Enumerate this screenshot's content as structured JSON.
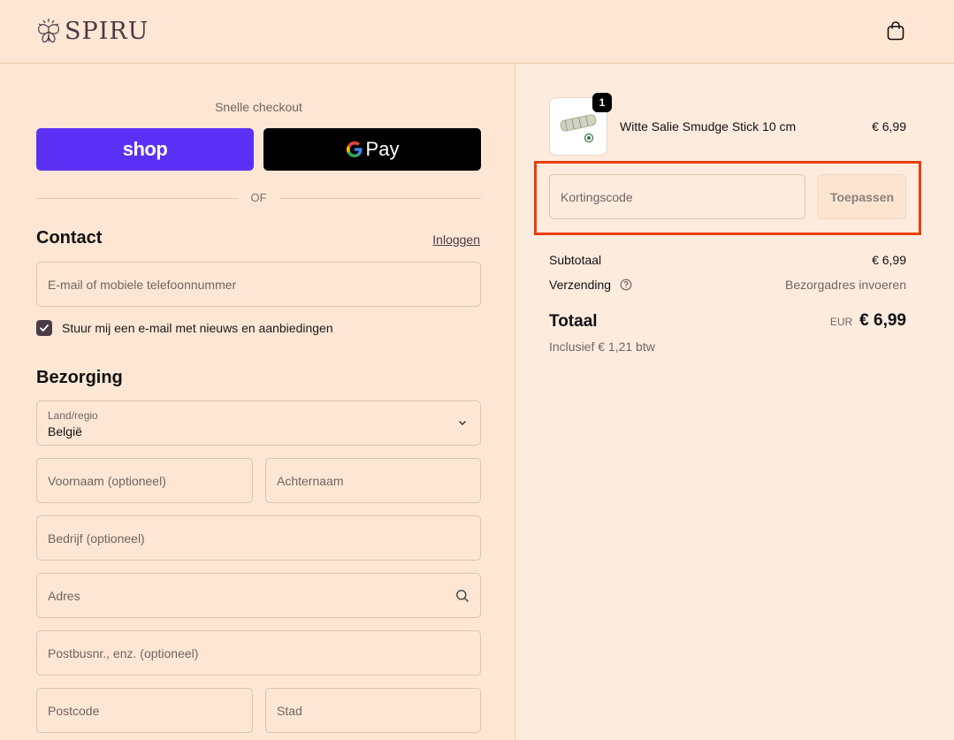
{
  "header": {
    "brand": "SPIRU",
    "cart_icon": "shopping-bag-icon"
  },
  "checkout": {
    "express_label": "Snelle checkout",
    "shop_pay_label": "shop",
    "gpay_label": "Pay",
    "or_label": "OF"
  },
  "contact": {
    "title": "Contact",
    "login_link": "Inloggen",
    "email_placeholder": "E-mail of mobiele telefoonnummer",
    "newsletter_label": "Stuur mij een e-mail met nieuws en aanbiedingen",
    "newsletter_checked": true
  },
  "delivery": {
    "title": "Bezorging",
    "country_label": "Land/regio",
    "country_value": "België",
    "first_name_placeholder": "Voornaam (optioneel)",
    "last_name_placeholder": "Achternaam",
    "company_placeholder": "Bedrijf (optioneel)",
    "address_placeholder": "Adres",
    "address2_placeholder": "Postbusnr., enz. (optioneel)",
    "postcode_placeholder": "Postcode",
    "city_placeholder": "Stad"
  },
  "summary": {
    "product": {
      "name": "Witte Salie Smudge Stick 10 cm",
      "price": "€ 6,99",
      "quantity": "1"
    },
    "discount_placeholder": "Kortingscode",
    "apply_label": "Toepassen",
    "subtotal_label": "Subtotaal",
    "subtotal_value": "€ 6,99",
    "shipping_label": "Verzending",
    "shipping_value": "Bezorgadres invoeren",
    "total_label": "Totaal",
    "currency": "EUR",
    "total_value": "€ 6,99",
    "vat_note": "Inclusief € 1,21 btw"
  },
  "colors": {
    "background": "#fde6d4",
    "shop_pay": "#5a31f4",
    "brand_dark": "#4a3b45",
    "highlight": "#e8400c"
  }
}
